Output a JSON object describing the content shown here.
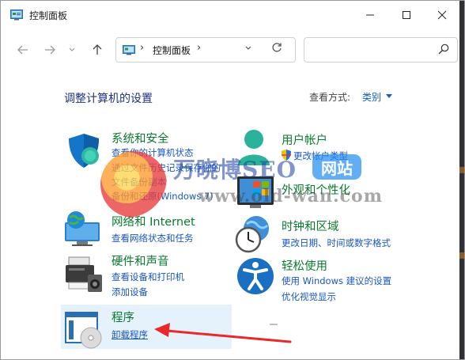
{
  "window": {
    "title": "控制面板"
  },
  "toolbar": {
    "address_path": "控制面板",
    "search_placeholder": ""
  },
  "header": {
    "title": "调整计算机的设置",
    "view_by_label": "查看方式:",
    "view_by_value": "类别"
  },
  "categories": {
    "system": {
      "title": "系统和安全",
      "links": [
        "查看你的计算机状态",
        "通过文件历史记录保存你的文件备份副本",
        "备份和还原(Windows 7)"
      ],
      "link_display": [
        "查看你的计算机状态",
        "通过文件历史记录保存你的",
        "文件备份副本",
        "备份和还原(Windows 7)"
      ]
    },
    "user": {
      "title": "用户帐户",
      "links": [
        "更改帐户类型"
      ]
    },
    "network": {
      "title": "网络和 Internet",
      "links": [
        "查看网络状态和任务"
      ]
    },
    "appearance": {
      "title": "外观和个性化",
      "links": []
    },
    "hardware": {
      "title": "硬件和声音",
      "links": [
        "查看设备和打印机",
        "添加设备"
      ]
    },
    "clock": {
      "title": "时钟和区域",
      "links": [
        "更改日期、时间或数字格式"
      ]
    },
    "programs": {
      "title": "程序",
      "links": [
        "卸载程序"
      ]
    },
    "ease": {
      "title": "轻松使用",
      "links": [
        "使用 Windows 建议的设置",
        "优化视觉显示"
      ]
    }
  },
  "watermark": {
    "text": "万晓博SEO",
    "badge": "网站",
    "url": "www.old-wan.com"
  },
  "icons": {
    "minimize": "minimize-icon",
    "maximize": "maximize-icon",
    "close": "close-icon",
    "back": "back-arrow-icon",
    "forward": "forward-arrow-icon",
    "up": "up-arrow-icon",
    "refresh": "refresh-icon",
    "search": "search-icon"
  },
  "colors": {
    "category_title": "#0a7a2e",
    "link": "#1a56c4",
    "heading": "#1e3287",
    "selected_bg": "#e5f1fb",
    "annotation_arrow": "#e8292b"
  }
}
